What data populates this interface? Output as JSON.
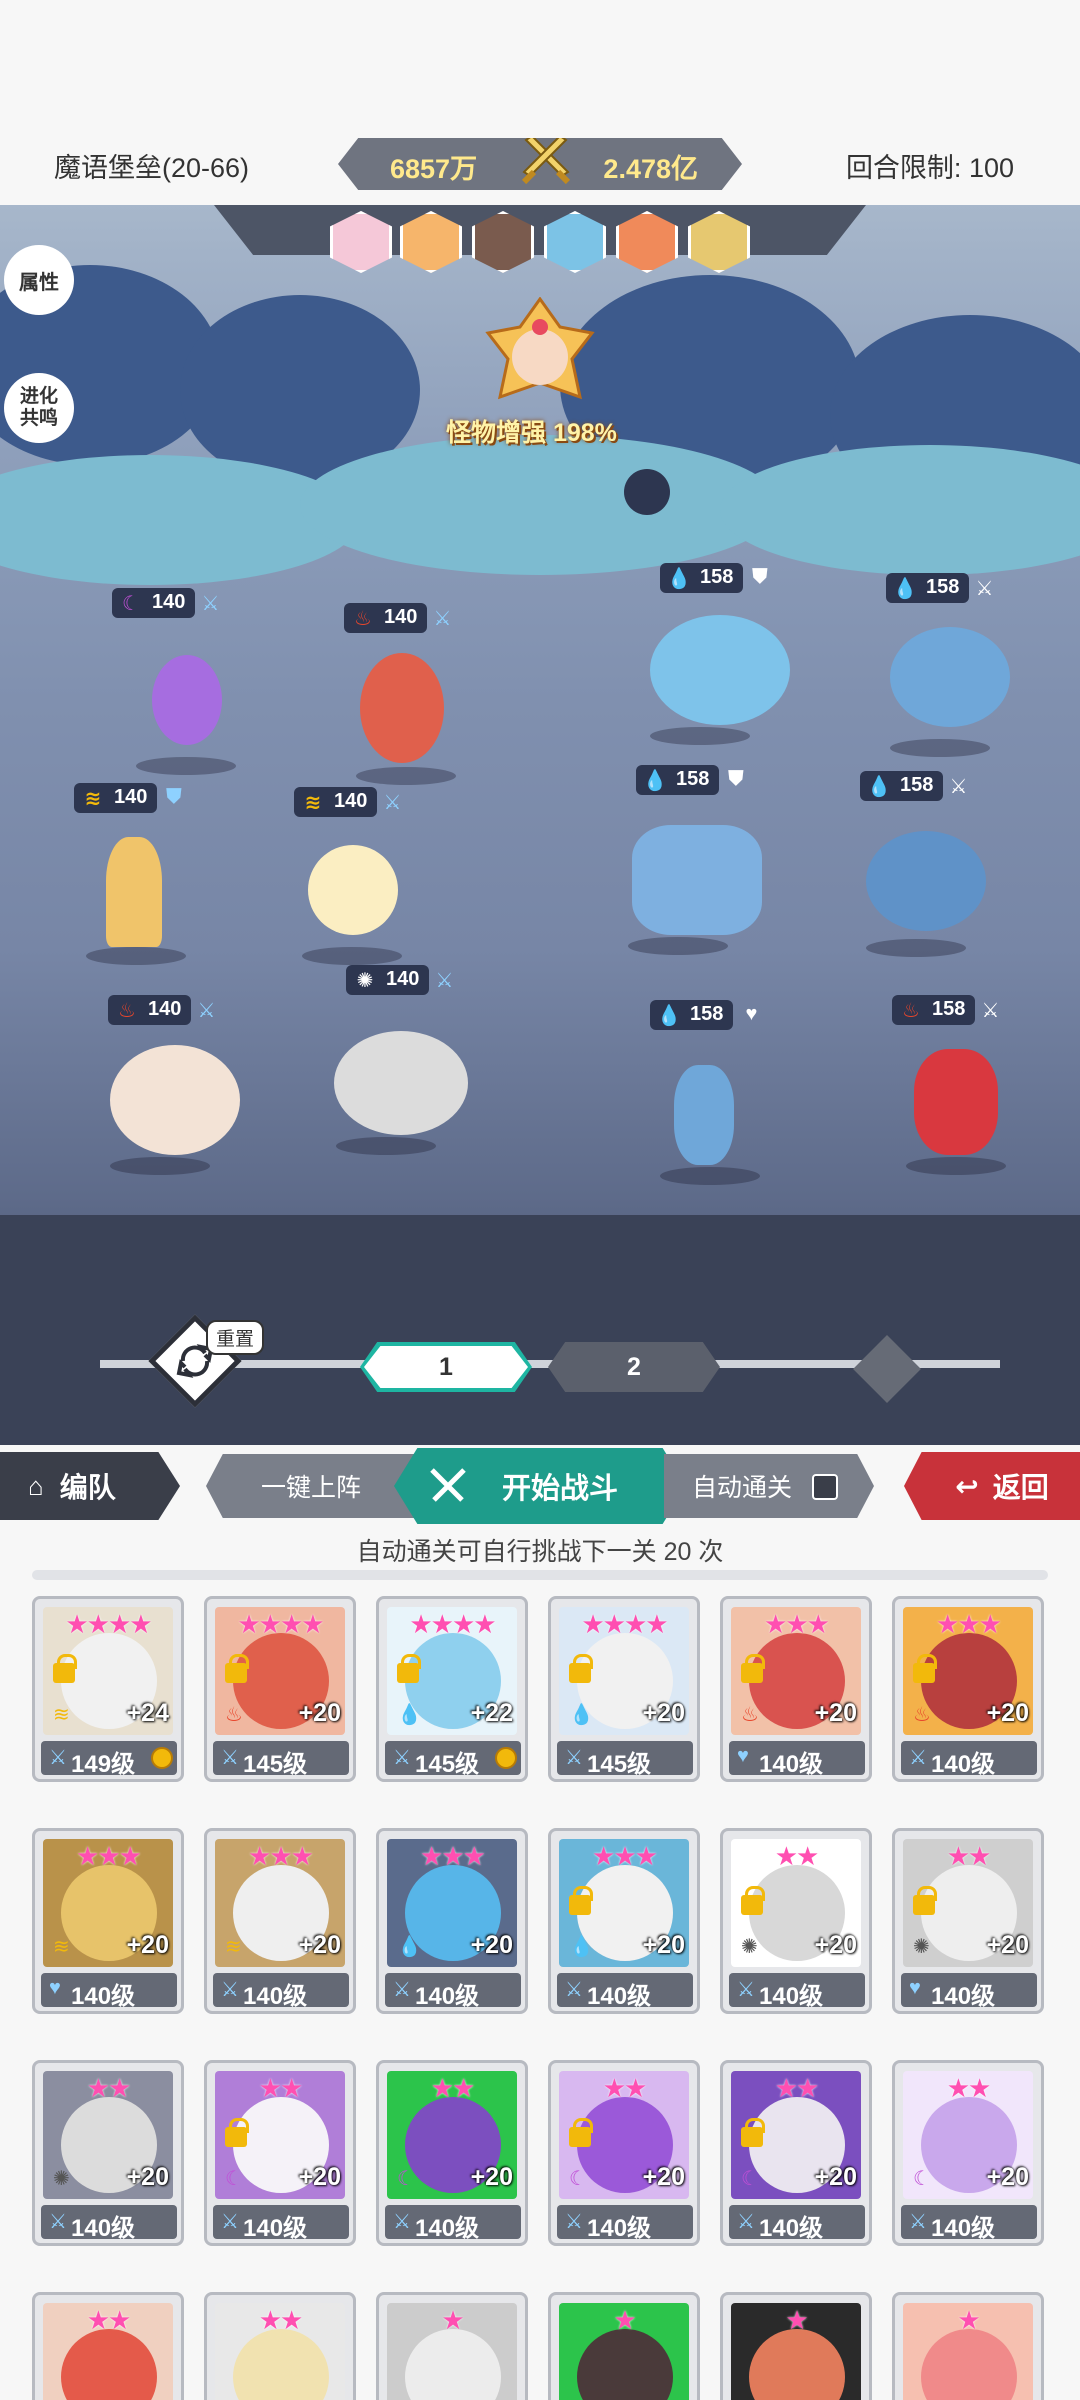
{
  "header": {
    "stage_title": "魔语堡垒(20-66)",
    "power_left": "6857万",
    "power_right": "2.478亿",
    "round_limit": "回合限制: 100"
  },
  "battle": {
    "side_attr": "属性",
    "side_evo": "进化\n共鸣",
    "boost_label": "怪物增强 198%",
    "enemy_portraits": [
      "#f5c8d8",
      "#f6b56b",
      "#7a5b4e",
      "#7cc3e6",
      "#f08a5a",
      "#e6c870"
    ],
    "ally_tags": [
      {
        "level": "140",
        "elem": "☾",
        "elem_color": "#c04fd6",
        "sub": "⚔"
      },
      {
        "level": "140",
        "elem": "♨",
        "elem_color": "#e8462c",
        "sub": "⚔"
      },
      {
        "level": "140",
        "elem": "≋",
        "elem_color": "#f2b90b",
        "sub": "⛊"
      },
      {
        "level": "140",
        "elem": "≋",
        "elem_color": "#f2b90b",
        "sub": "⚔"
      },
      {
        "level": "140",
        "elem": "♨",
        "elem_color": "#e8462c",
        "sub": "⚔"
      },
      {
        "level": "140",
        "elem": "✺",
        "elem_color": "#ffffff",
        "sub": "⚔"
      }
    ],
    "enemy_tags": [
      {
        "level": "158",
        "elem": "💧",
        "sub": "⛊"
      },
      {
        "level": "158",
        "elem": "💧",
        "sub": "⚔"
      },
      {
        "level": "158",
        "elem": "💧",
        "sub": "⛊"
      },
      {
        "level": "158",
        "elem": "💧",
        "sub": "⚔"
      },
      {
        "level": "158",
        "elem": "💧",
        "sub": "♥"
      },
      {
        "level": "158",
        "elem": "♨",
        "sub": "⚔"
      }
    ]
  },
  "waves": {
    "reset_label": "重置",
    "wave1": "1",
    "wave2": "2"
  },
  "actions": {
    "team": "编队",
    "auto_deploy": "一键上阵",
    "start": "开始战斗",
    "auto_clear": "自动通关",
    "back": "返回"
  },
  "auto_note": "自动通关可自行挑战下一关 20 次",
  "heroes": [
    {
      "stars": "★★★★",
      "plus": "+24",
      "level": "149级",
      "lock": true,
      "gold": true,
      "elem": "≋",
      "color": "#f1f1f1",
      "accent": "#e8e0d0",
      "lvl_icon": "⚔"
    },
    {
      "stars": "★★★★",
      "plus": "+20",
      "level": "145级",
      "lock": true,
      "gold": false,
      "elem": "♨",
      "color": "#e0604c",
      "accent": "#f0b7a0",
      "lvl_icon": "⚔"
    },
    {
      "stars": "★★★★",
      "plus": "+22",
      "level": "145级",
      "lock": true,
      "gold": true,
      "elem": "💧",
      "color": "#8fd0ee",
      "accent": "#e8f4fa",
      "lvl_icon": "⚔"
    },
    {
      "stars": "★★★★",
      "plus": "+20",
      "level": "145级",
      "lock": true,
      "gold": false,
      "elem": "💧",
      "color": "#f1f1f1",
      "accent": "#dbe8f5",
      "lvl_icon": "⚔"
    },
    {
      "stars": "★★★",
      "plus": "+20",
      "level": "140级",
      "lock": true,
      "gold": false,
      "elem": "♨",
      "color": "#d9534f",
      "accent": "#f2c1a8",
      "lvl_icon": "♥"
    },
    {
      "stars": "★★★",
      "plus": "+20",
      "level": "140级",
      "lock": true,
      "gold": false,
      "elem": "♨",
      "color": "#b8403e",
      "accent": "#f3b14a",
      "lvl_icon": "⚔"
    },
    {
      "stars": "★★★",
      "plus": "+20",
      "level": "140级",
      "lock": false,
      "gold": false,
      "elem": "≋",
      "color": "#e7c36a",
      "accent": "#b9924a",
      "lvl_icon": "♥"
    },
    {
      "stars": "★★★",
      "plus": "+20",
      "level": "140级",
      "lock": false,
      "gold": false,
      "elem": "≋",
      "color": "#efefef",
      "accent": "#c7a46b",
      "lvl_icon": "⚔"
    },
    {
      "stars": "★★★",
      "plus": "+20",
      "level": "140级",
      "lock": false,
      "gold": false,
      "elem": "💧",
      "color": "#57b5e8",
      "accent": "#5a6b8c",
      "lvl_icon": "⚔"
    },
    {
      "stars": "★★★",
      "plus": "+20",
      "level": "140级",
      "lock": true,
      "gold": false,
      "elem": "💧",
      "color": "#f1f1f1",
      "accent": "#6ab6d9",
      "lvl_icon": "⚔"
    },
    {
      "stars": "★★",
      "plus": "+20",
      "level": "140级",
      "lock": true,
      "gold": false,
      "elem": "✺",
      "color": "#d8d8d8",
      "accent": "#ffffff",
      "lvl_icon": "⚔"
    },
    {
      "stars": "★★",
      "plus": "+20",
      "level": "140级",
      "lock": true,
      "gold": false,
      "elem": "✺",
      "color": "#eeeeee",
      "accent": "#cfcfcf",
      "lvl_icon": "♥"
    },
    {
      "stars": "★★",
      "plus": "+20",
      "level": "140级",
      "lock": false,
      "gold": false,
      "elem": "✺",
      "color": "#dcdcdc",
      "accent": "#8b8ea0",
      "lvl_icon": "⚔"
    },
    {
      "stars": "★★",
      "plus": "+20",
      "level": "140级",
      "lock": true,
      "gold": false,
      "elem": "☾",
      "color": "#f5f2f8",
      "accent": "#b07ed8",
      "lvl_icon": "⚔"
    },
    {
      "stars": "★★",
      "plus": "+20",
      "level": "140级",
      "lock": false,
      "gold": false,
      "elem": "☾",
      "color": "#7c4fbf",
      "accent": "#2cc44b",
      "lvl_icon": "⚔"
    },
    {
      "stars": "★★",
      "plus": "+20",
      "level": "140级",
      "lock": true,
      "gold": false,
      "elem": "☾",
      "color": "#9b59d9",
      "accent": "#d8b8f0",
      "lvl_icon": "⚔"
    },
    {
      "stars": "★★",
      "plus": "+20",
      "level": "140级",
      "lock": true,
      "gold": false,
      "elem": "☾",
      "color": "#e9e4ef",
      "accent": "#7b4fbf",
      "lvl_icon": "⚔"
    },
    {
      "stars": "★★",
      "plus": "+20",
      "level": "140级",
      "lock": false,
      "gold": false,
      "elem": "☾",
      "color": "#c9a8ec",
      "accent": "#f1e6fb",
      "lvl_icon": "⚔"
    },
    {
      "stars": "★★",
      "plus": "",
      "level": "",
      "lock": false,
      "gold": false,
      "elem": "",
      "color": "#e45a4a",
      "accent": "#f0d0c0",
      "lvl_icon": ""
    },
    {
      "stars": "★★",
      "plus": "",
      "level": "",
      "lock": false,
      "gold": false,
      "elem": "",
      "color": "#f1e2b0",
      "accent": "#e8e8e8",
      "lvl_icon": ""
    },
    {
      "stars": "★",
      "plus": "",
      "level": "",
      "lock": false,
      "gold": false,
      "elem": "",
      "color": "#ececec",
      "accent": "#cccccc",
      "lvl_icon": ""
    },
    {
      "stars": "★",
      "plus": "",
      "level": "",
      "lock": false,
      "gold": false,
      "elem": "",
      "color": "#4a3a3a",
      "accent": "#2cc44b",
      "lvl_icon": ""
    },
    {
      "stars": "★",
      "plus": "",
      "level": "",
      "lock": false,
      "gold": false,
      "elem": "",
      "color": "#e07a5a",
      "accent": "#2a2a2a",
      "lvl_icon": ""
    },
    {
      "stars": "★",
      "plus": "",
      "level": "",
      "lock": false,
      "gold": false,
      "elem": "",
      "color": "#f08a8a",
      "accent": "#f6c0b0",
      "lvl_icon": ""
    }
  ]
}
